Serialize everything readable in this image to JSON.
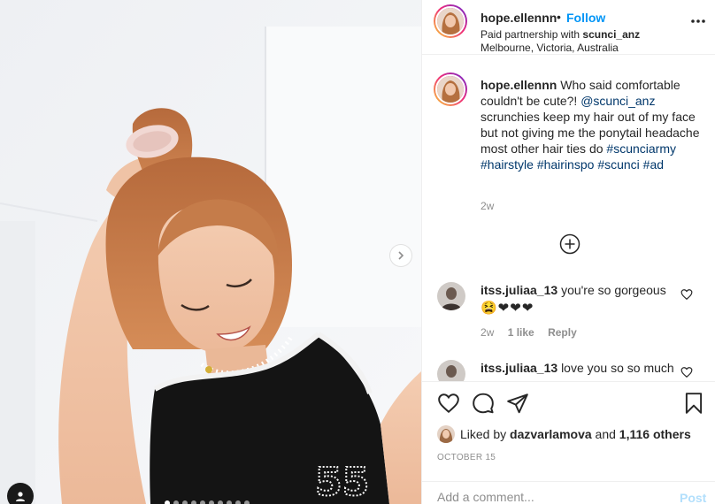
{
  "post": {
    "username": "hope.ellennn",
    "separator": "•",
    "follow_label": "Follow",
    "partnership_prefix": "Paid partnership with",
    "partner": "scunci_anz",
    "location": "Melbourne, Victoria, Australia"
  },
  "caption": {
    "username": "hope.ellennn",
    "text_before_mention": "Who said comfortable couldn't be cute?!",
    "mention": "@scunci_anz",
    "text_after_mention": "scrunchies keep my hair out of my face but not giving me the ponytail headache most other hair ties do",
    "hashtags": [
      "#scunciarmy",
      "#hairstyle",
      "#hairinspo",
      "#scunci",
      "#ad"
    ],
    "age": "2w"
  },
  "comments": [
    {
      "username": "itss.juliaa_13",
      "text": "you're so gorgeous",
      "emojis": "😫❤❤❤",
      "age": "2w",
      "likes": "1 like",
      "reply_label": "Reply"
    },
    {
      "username": "itss.juliaa_13",
      "text": "love you so so much",
      "emojis": "",
      "age": "",
      "likes": "",
      "reply_label": ""
    }
  ],
  "likes": {
    "prefix": "Liked by",
    "liker": "dazvarlamova",
    "middle": "and",
    "others": "1,116 others"
  },
  "date": "OCTOBER 15",
  "add_comment": {
    "placeholder": "Add a comment...",
    "post_label": "Post"
  },
  "carousel": {
    "slide_count": 10,
    "active_index": 0
  },
  "colors": {
    "link": "#0095f6",
    "mention": "#00376b",
    "muted": "#8e8e8e",
    "text": "#262626",
    "post_disabled": "#b2dffc"
  },
  "icons": {
    "more": "more-horizontal-icon",
    "load_more": "plus-circle-icon",
    "like": "heart-icon",
    "comment": "comment-bubble-icon",
    "share": "paper-plane-icon",
    "save": "bookmark-icon",
    "next": "chevron-right-icon",
    "tags": "user-tag-icon"
  }
}
